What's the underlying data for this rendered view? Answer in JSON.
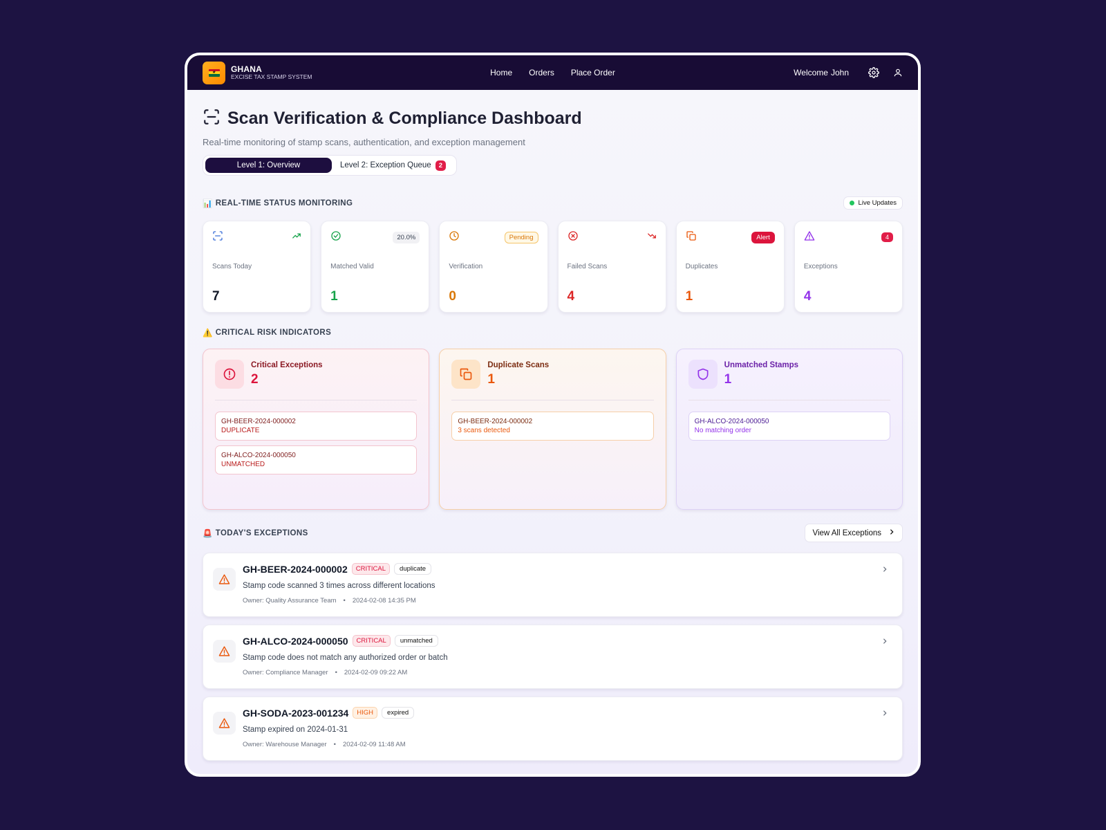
{
  "brand": {
    "name": "GHANA",
    "subtitle": "EXCISE TAX STAMP SYSTEM"
  },
  "nav": {
    "links": [
      "Home",
      "Orders",
      "Place Order"
    ],
    "welcome": "Welcome",
    "user": "John"
  },
  "page": {
    "title": "Scan Verification & Compliance Dashboard",
    "subtitle": "Real-time monitoring of stamp scans, authentication, and exception management"
  },
  "tabs": [
    {
      "label": "Level 1: Overview"
    },
    {
      "label": "Level 2: Exception Queue",
      "badge": "2"
    }
  ],
  "status_section": {
    "title": "REAL-TIME STATUS MONITORING",
    "live": "Live Updates",
    "emoji": "📊"
  },
  "stats": [
    {
      "label": "Scans Today",
      "value": "7",
      "color": "#111827",
      "icon": "scan-icon",
      "indicator": "trend-up-icon"
    },
    {
      "label": "Matched Valid",
      "value": "1",
      "color": "#16a34a",
      "icon": "check-circle-icon",
      "chip": "20.0%"
    },
    {
      "label": "Verification",
      "value": "0",
      "color": "#d97706",
      "icon": "clock-icon",
      "chip": "Pending"
    },
    {
      "label": "Failed Scans",
      "value": "4",
      "color": "#dc2626",
      "icon": "x-circle-icon",
      "indicator": "trend-down-icon"
    },
    {
      "label": "Duplicates",
      "value": "1",
      "color": "#ea580c",
      "icon": "copy-icon",
      "chip": "Alert"
    },
    {
      "label": "Exceptions",
      "value": "4",
      "color": "#9333ea",
      "icon": "warning-icon",
      "chip": "4"
    }
  ],
  "risk_section": {
    "title": "CRITICAL RISK INDICATORS",
    "emoji": "⚠️"
  },
  "risks": [
    {
      "title": "Critical Exceptions",
      "count": "2",
      "icon": "alert-circle-icon",
      "items": [
        {
          "code": "GH-BEER-2024-000002",
          "sub": "DUPLICATE"
        },
        {
          "code": "GH-ALCO-2024-000050",
          "sub": "UNMATCHED"
        }
      ]
    },
    {
      "title": "Duplicate Scans",
      "count": "1",
      "icon": "copy-icon",
      "items": [
        {
          "code": "GH-BEER-2024-000002",
          "sub": "3 scans detected"
        }
      ]
    },
    {
      "title": "Unmatched Stamps",
      "count": "1",
      "icon": "shield-icon",
      "items": [
        {
          "code": "GH-ALCO-2024-000050",
          "sub": "No matching order"
        }
      ]
    }
  ],
  "exceptions_section": {
    "title": "TODAY'S EXCEPTIONS",
    "emoji": "🚨",
    "view_all": "View All Exceptions"
  },
  "exceptions": [
    {
      "code": "GH-BEER-2024-000002",
      "severity": "CRITICAL",
      "type": "duplicate",
      "description": "Stamp code scanned 3 times across different locations",
      "owner": "Owner: Quality Assurance Team",
      "sep": "•",
      "time": "2024-02-08 14:35 PM"
    },
    {
      "code": "GH-ALCO-2024-000050",
      "severity": "CRITICAL",
      "type": "unmatched",
      "description": "Stamp code does not match any authorized order or batch",
      "owner": "Owner: Compliance Manager",
      "sep": "•",
      "time": "2024-02-09 09:22 AM"
    },
    {
      "code": "GH-SODA-2023-001234",
      "severity": "HIGH",
      "type": "expired",
      "description": "Stamp expired on 2024-01-31",
      "owner": "Owner: Warehouse Manager",
      "sep": "•",
      "time": "2024-02-09 11:48 AM"
    }
  ]
}
